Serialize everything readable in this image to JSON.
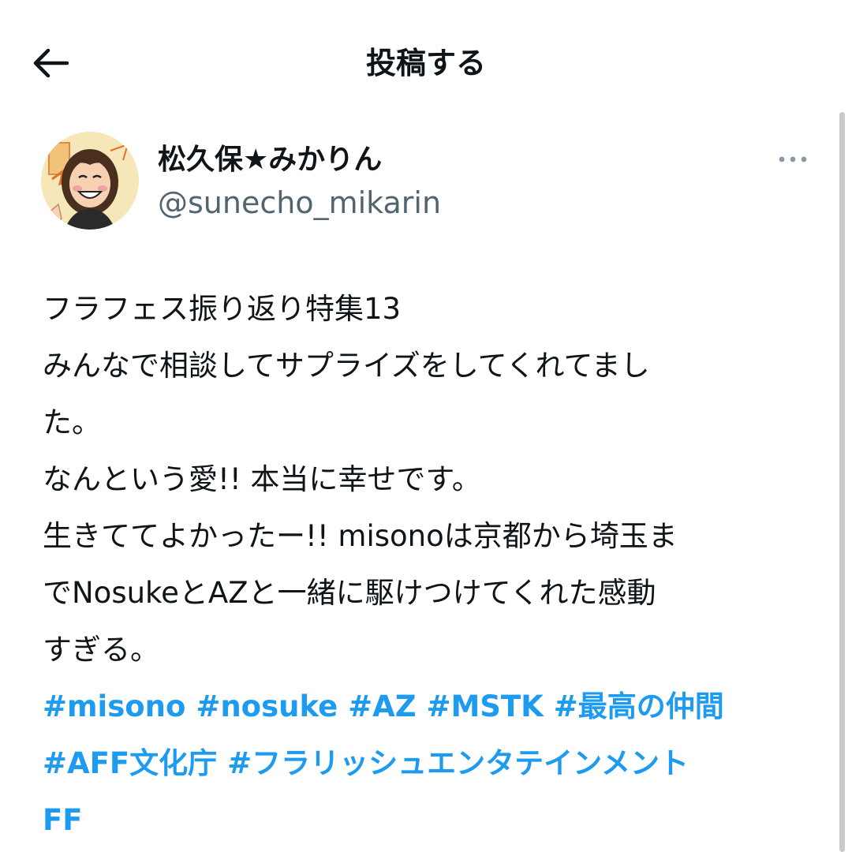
{
  "header": {
    "title": "投稿する",
    "back_icon": "arrow-left-icon"
  },
  "user": {
    "display_name": "松久保★みかりん",
    "handle": "@sunecho_mikarin",
    "avatar_icon": "cartoon-avatar",
    "more_icon": "more-horizontal-icon"
  },
  "post": {
    "lines": [
      "フラフェス振り返り特集13",
      "みんなで相談してサプライズをしてくれてまし",
      "た。",
      "なんという愛!! 本当に幸せです。",
      "生きててよかったー!! misonoは京都から埼玉ま",
      "でNosukeとAZと一緒に駆けつけてくれた感動",
      "すぎる。"
    ],
    "hashtag_lines": [
      [
        "#misono",
        "#nosuke",
        "#AZ",
        "#MSTK",
        "#最高の仲間"
      ],
      [
        "#AFF文化庁",
        "#フラリッシュエンタテインメント"
      ],
      [
        "FF"
      ]
    ]
  },
  "colors": {
    "text": "#0f1419",
    "secondary": "#536471",
    "link": "#1d9bf0",
    "scrollbar": "#c9c9c9"
  }
}
